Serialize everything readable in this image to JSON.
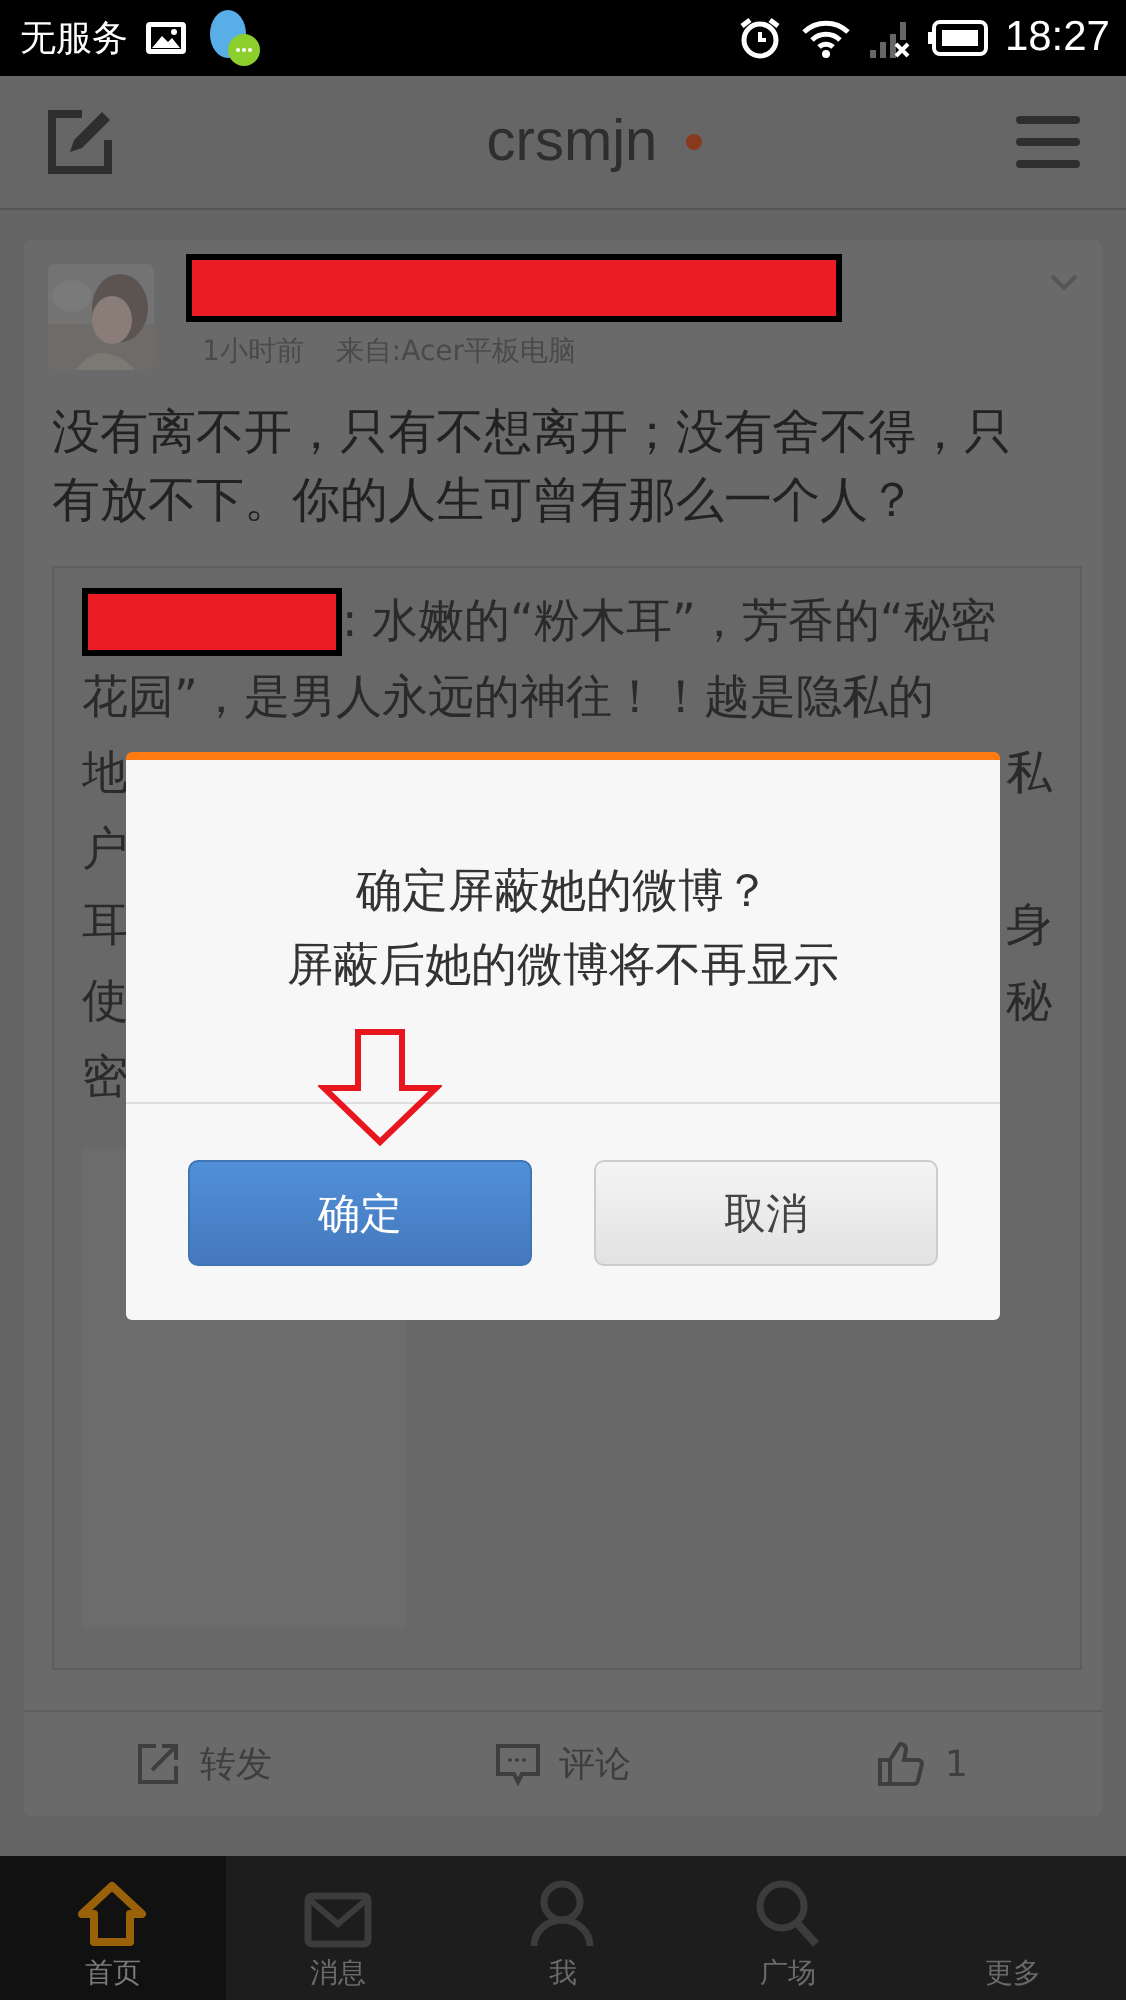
{
  "status_bar": {
    "carrier": "无服务",
    "time": "18:27"
  },
  "header": {
    "title": "crsmjn",
    "unread_dot": true
  },
  "post": {
    "meta_time": "1小时前",
    "source": "来自:Acer平板电脑",
    "text": "没有离不开，只有不想离开；没有舍不得，只有放不下。你的人生可曾有那么一个人？"
  },
  "repost": {
    "lead": ": 水嫩的“粉木耳”，芳香的“秘密",
    "line_2": "花园”，是男人永远的神往！！越是隐私的",
    "fragments": [
      {
        "left": "地",
        "right": "私"
      },
      {
        "left": "户"
      },
      {
        "left": "耳",
        "right": "身"
      },
      {
        "left": "使",
        "right": "秘"
      },
      {
        "left": "密"
      }
    ]
  },
  "actions": [
    {
      "kind": "repost",
      "label": "转发"
    },
    {
      "kind": "comment",
      "label": "评论"
    },
    {
      "kind": "like",
      "label": "1"
    }
  ],
  "tabs": [
    {
      "kind": "home",
      "label": "首页",
      "selected": true
    },
    {
      "kind": "mail",
      "label": "消息",
      "selected": false
    },
    {
      "kind": "me",
      "label": "我",
      "selected": false
    },
    {
      "kind": "search",
      "label": "广场",
      "selected": false
    },
    {
      "kind": "more",
      "label": "更多",
      "selected": false
    }
  ],
  "dialog": {
    "lines": [
      "确定屏蔽她的微博？",
      "屏蔽后她的微博将不再显示"
    ],
    "buttons": [
      {
        "kind": "primary",
        "label": "确定"
      },
      {
        "kind": "secondary",
        "label": "取消"
      }
    ]
  }
}
